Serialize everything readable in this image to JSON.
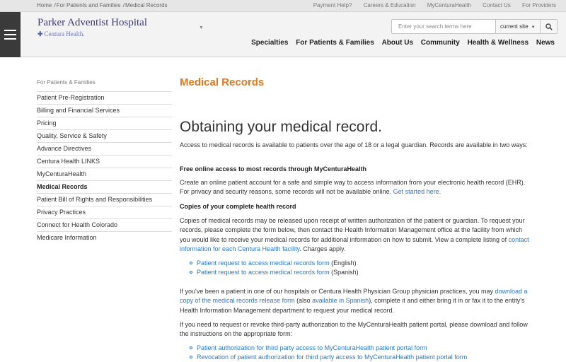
{
  "breadcrumb": {
    "home": "Home",
    "section": "For Patients and Families",
    "current": "Medical Records"
  },
  "utility_links": [
    "Payment Help?",
    "Careers & Education",
    "MyCenturaHealth",
    "Contact Us",
    "For Providers"
  ],
  "logo": {
    "title": "Parker Adventist Hospital",
    "subtitle": "Centura Health."
  },
  "search": {
    "placeholder": "Enter your search terms here",
    "scope": "current site"
  },
  "main_nav": [
    "Specialties",
    "For Patients & Families",
    "About Us",
    "Community",
    "Health & Wellness",
    "News"
  ],
  "sidebar": {
    "heading": "For Patients & Families",
    "items": [
      "Patient Pre-Registration",
      "Billing and Financial Services",
      "Pricing",
      "Quality, Service & Safety",
      "Advance Directives",
      "Centura Health LINKS",
      "MyCenturaHealth",
      "Medical Records",
      "Patient Bill of Rights and Responsibilities",
      "Privacy Practices",
      "Connect for Health Colorado",
      "Medicare Information"
    ]
  },
  "content": {
    "section_title": "Medical Records",
    "heading": "Obtaining your medical record.",
    "intro": "Access to medical records is available to patients over the age of 18 or a legal guardian. Records are available in two ways:",
    "online_heading": "Free online access to most records through MyCenturaHealth",
    "online_text": "Create an online patient account for a safe and simple way to access information from your electronic health record (EHR). For privacy and security reasons, some records will not be available online.",
    "online_link": "Get started here.",
    "copies_heading": "Copies of your complete health record",
    "copies_text": "Copies of medical records may be released upon receipt of written authorization of the patient or guardian. To request your records, please complete the form below, then contact the Health Information Management office at the facility from which you would like to receive your medical records for additional information on how to submit. View a complete listing of",
    "copies_link": "contact information for each Centura Health facility",
    "copies_tail": ". Charges apply.",
    "forms": [
      {
        "link": "Patient request to access medical records form",
        "lang": "(English)"
      },
      {
        "link": "Patient request to access medical records form",
        "lang": "(Spanish)"
      }
    ],
    "physician_text_a": "If you've been a patient in one of our hospitals or Centura Health Physician Group physician practices, you may",
    "physician_link_a": "download a copy of the medical records release form",
    "physician_text_b": "(also",
    "physician_link_b": "available in Spanish",
    "physician_text_c": "), complete it and either bring it in or fax it to the entity's Health Information Management department  to request your medical record.",
    "third_party_text": "If you need to request or revoke third-party authorization to the MyCenturaHealth patient portal, please download and follow the instructions on the appropriate form:",
    "third_party_forms": [
      "Patient authorization for third party access to MyCenturaHealth patient portal form",
      "Revocation of patient authorization for third party access to MyCenturaHealth patient portal form"
    ]
  }
}
